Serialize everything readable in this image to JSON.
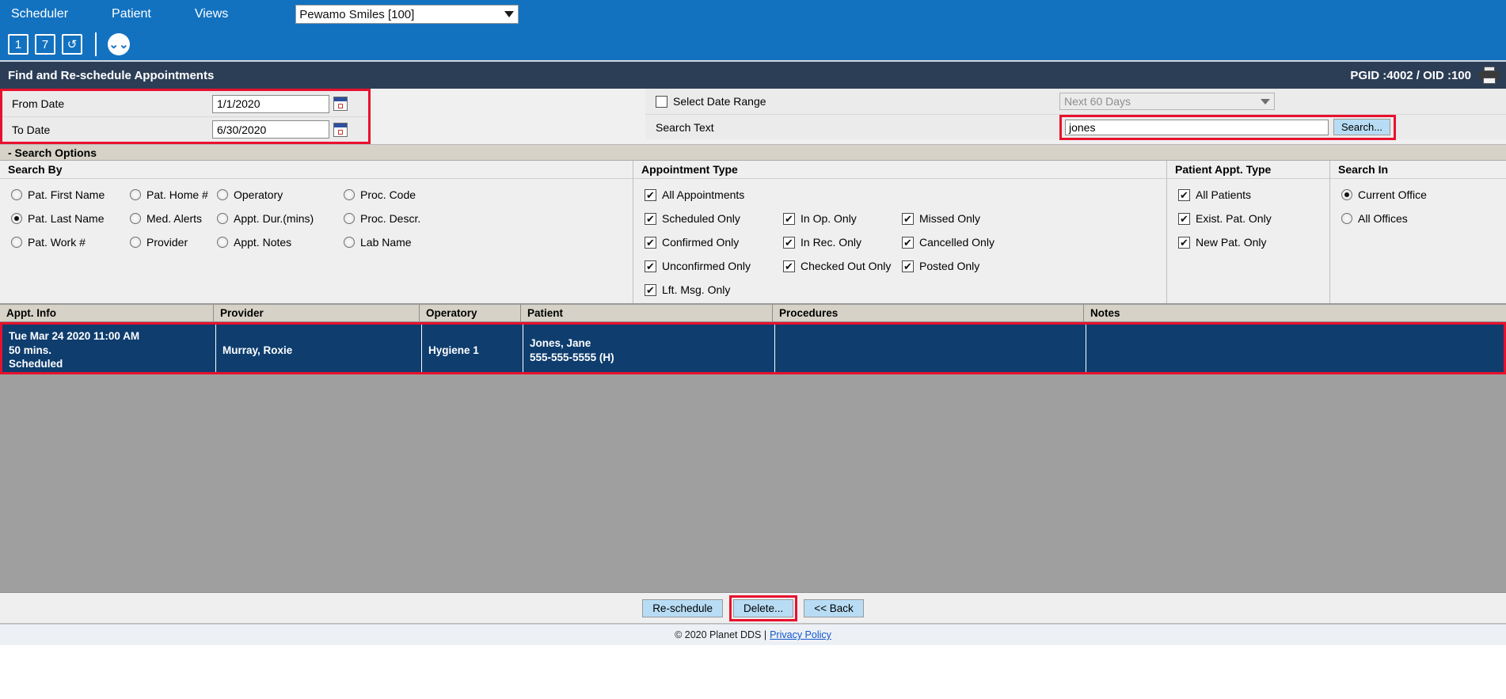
{
  "menubar": {
    "items": [
      {
        "label": "Scheduler"
      },
      {
        "label": "Patient"
      },
      {
        "label": "Views"
      }
    ],
    "office_select": {
      "value": "Pewamo Smiles [100]"
    }
  },
  "toolbar": {
    "day_view": "1",
    "week_view": "7",
    "refresh": "↺",
    "expand": "⌄⌄"
  },
  "page_header": {
    "title": "Find and Re-schedule Appointments",
    "ids": "PGID :4002  /  OID :100",
    "print_icon": "printer-icon"
  },
  "criteria": {
    "from_date": {
      "label": "From Date",
      "value": "1/1/2020"
    },
    "to_date": {
      "label": "To Date",
      "value": "6/30/2020"
    },
    "select_date_range": {
      "label": "Select Date Range",
      "checked": false,
      "mark": ""
    },
    "date_range_select": {
      "value": "Next 60 Days"
    },
    "search_text": {
      "label": "Search Text",
      "value": "jones"
    },
    "search_button": "Search..."
  },
  "search_options": {
    "section_title": "- Search Options",
    "search_by": {
      "title": "Search By",
      "options": [
        {
          "label": "Pat. First Name",
          "selected": false
        },
        {
          "label": "Pat. Home #",
          "selected": false
        },
        {
          "label": "Operatory",
          "selected": false
        },
        {
          "label": "Proc. Code",
          "selected": false
        },
        {
          "label": "Pat. Last Name",
          "selected": true
        },
        {
          "label": "Med. Alerts",
          "selected": false
        },
        {
          "label": "Appt. Dur.(mins)",
          "selected": false
        },
        {
          "label": "Proc. Descr.",
          "selected": false
        },
        {
          "label": "Pat. Work #",
          "selected": false
        },
        {
          "label": "Provider",
          "selected": false
        },
        {
          "label": "Appt. Notes",
          "selected": false
        },
        {
          "label": "Lab Name",
          "selected": false
        }
      ]
    },
    "appointment_type": {
      "title": "Appointment Type",
      "all": {
        "label": "All Appointments",
        "checked": true,
        "mark": "✔"
      },
      "options": [
        {
          "label": "Scheduled Only",
          "checked": true,
          "mark": "✔"
        },
        {
          "label": "In Op. Only",
          "checked": true,
          "mark": "✔"
        },
        {
          "label": "Missed Only",
          "checked": true,
          "mark": "✔"
        },
        {
          "label": "Confirmed Only",
          "checked": true,
          "mark": "✔"
        },
        {
          "label": "In Rec. Only",
          "checked": true,
          "mark": "✔"
        },
        {
          "label": "Cancelled Only",
          "checked": true,
          "mark": "✔"
        },
        {
          "label": "Unconfirmed Only",
          "checked": true,
          "mark": "✔"
        },
        {
          "label": "Checked Out Only",
          "checked": true,
          "mark": "✔"
        },
        {
          "label": "Posted Only",
          "checked": true,
          "mark": "✔"
        }
      ],
      "last": {
        "label": "Lft. Msg. Only",
        "checked": true,
        "mark": "✔"
      }
    },
    "patient_appt_type": {
      "title": "Patient Appt. Type",
      "options": [
        {
          "label": "All Patients",
          "checked": true,
          "mark": "✔"
        },
        {
          "label": "Exist. Pat. Only",
          "checked": true,
          "mark": "✔"
        },
        {
          "label": "New Pat. Only",
          "checked": true,
          "mark": "✔"
        }
      ]
    },
    "search_in": {
      "title": "Search In",
      "options": [
        {
          "label": "Current Office",
          "selected": true
        },
        {
          "label": "All Offices",
          "selected": false
        }
      ]
    }
  },
  "results": {
    "columns": [
      "Appt. Info",
      "Provider",
      "Operatory",
      "Patient",
      "Procedures",
      "Notes"
    ],
    "rows": [
      {
        "appt_datetime": "Tue Mar 24 2020 11:00 AM",
        "appt_duration": "50 mins.",
        "appt_status": "Scheduled",
        "provider": "Murray, Roxie",
        "operatory": "Hygiene 1",
        "patient_name": "Jones, Jane",
        "patient_phone": "555-555-5555 (H)",
        "procedures": "",
        "notes": "",
        "selected": true
      }
    ]
  },
  "footer": {
    "reschedule_label": "Re-schedule",
    "delete_label": "Delete...",
    "back_label": "<< Back",
    "copyright": "© 2020 Planet DDS |",
    "privacy_link": "Privacy Policy"
  },
  "colors": {
    "header_blue": "#1372c0",
    "title_navy": "#2c3e56",
    "highlight_red": "#e8112d",
    "row_selected_navy": "#0e3d6e",
    "button_blue": "#b8dcf4"
  }
}
